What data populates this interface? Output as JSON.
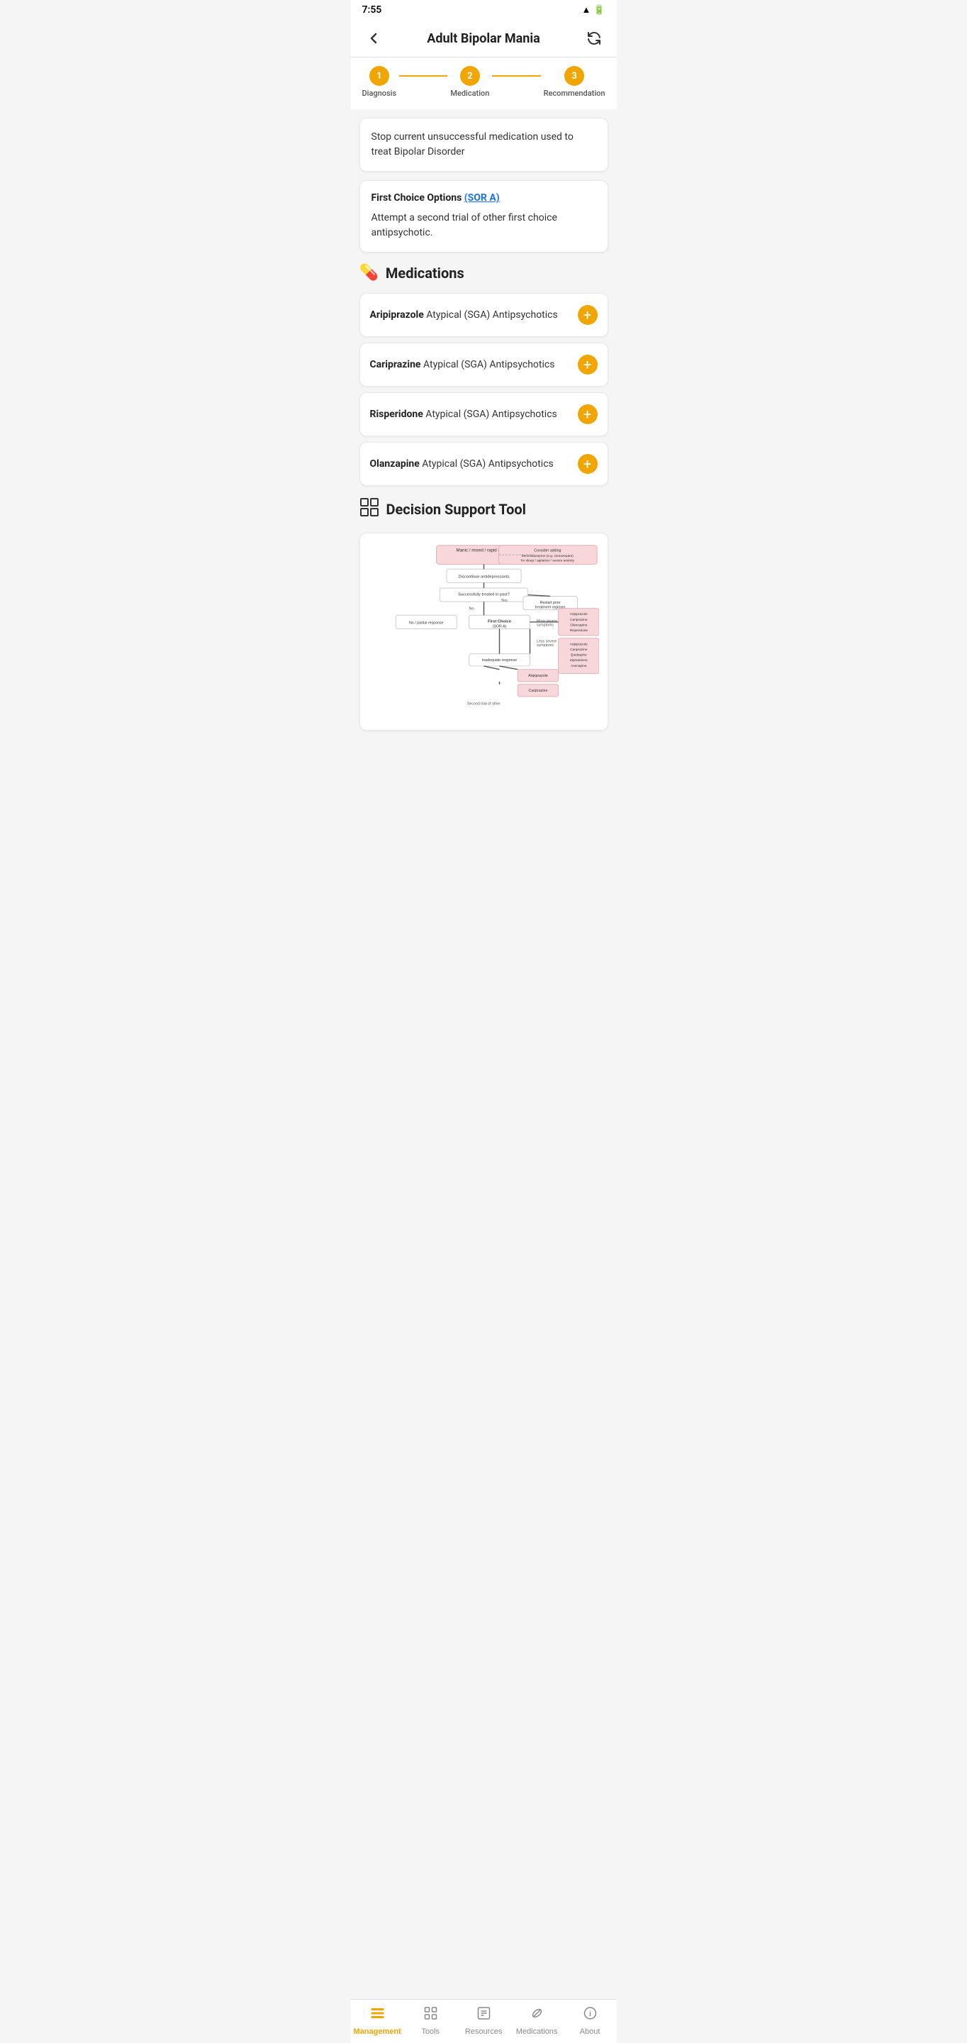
{
  "status_bar": {
    "time": "7:55",
    "icons": "📶🔋"
  },
  "header": {
    "title": "Adult Bipolar Mania",
    "back_label": "back",
    "refresh_label": "refresh"
  },
  "stepper": {
    "steps": [
      {
        "number": "1",
        "label": "Diagnosis"
      },
      {
        "number": "2",
        "label": "Medication"
      },
      {
        "number": "3",
        "label": "Recommendation"
      }
    ]
  },
  "stop_card": {
    "text": "Stop current unsuccessful medication used to treat Bipolar Disorder"
  },
  "first_choice_card": {
    "subtitle": "First Choice Options",
    "sor_label": "(SOR A)",
    "body": "Attempt a second trial of other first choice antipsychotic."
  },
  "medications_section": {
    "heading": "Medications",
    "icon": "💊",
    "items": [
      {
        "name": "Aripiprazole",
        "category": "Atypical (SGA) Antipsychotics"
      },
      {
        "name": "Cariprazine",
        "category": "Atypical (SGA) Antipsychotics"
      },
      {
        "name": "Risperidone",
        "category": "Atypical (SGA) Antipsychotics"
      },
      {
        "name": "Olanzapine",
        "category": "Atypical (SGA) Antipsychotics"
      }
    ]
  },
  "dst_section": {
    "heading": "Decision Support Tool",
    "icon": "🗂️"
  },
  "bottom_nav": {
    "items": [
      {
        "id": "management",
        "label": "Management",
        "icon": "📋",
        "active": true
      },
      {
        "id": "tools",
        "label": "Tools",
        "icon": "🔧",
        "active": false
      },
      {
        "id": "resources",
        "label": "Resources",
        "icon": "📚",
        "active": false
      },
      {
        "id": "medications",
        "label": "Medications",
        "icon": "💊",
        "active": false
      },
      {
        "id": "about",
        "label": "About",
        "icon": "ℹ️",
        "active": false
      }
    ]
  },
  "colors": {
    "accent": "#f0a500",
    "active_nav": "#f0a500",
    "inactive_nav": "#888888"
  }
}
